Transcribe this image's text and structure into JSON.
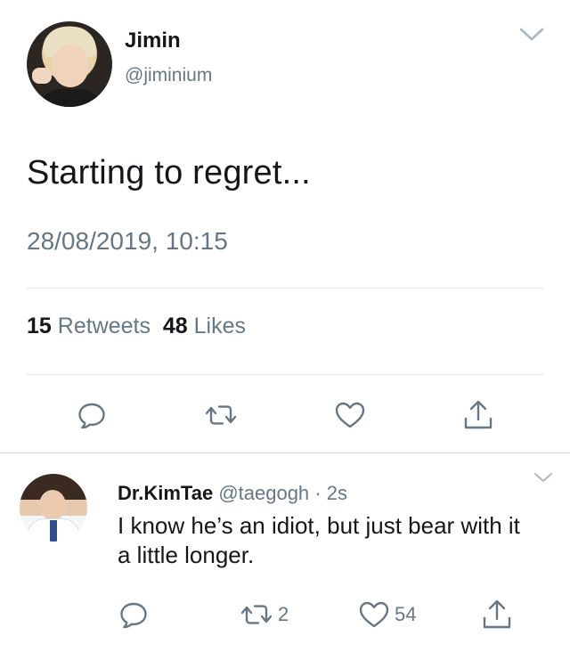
{
  "tweet": {
    "author_name": "Jimin",
    "author_handle": "@jiminium",
    "text": "Starting to regret...",
    "timestamp": "28/08/2019, 10:15",
    "retweets_count": "15",
    "retweets_label": "Retweets",
    "likes_count": "48",
    "likes_label": "Likes"
  },
  "reply": {
    "author_name": "Dr.KimTae",
    "author_handle": "@taegogh",
    "separator": "·",
    "age": "2s",
    "text": "I know he’s an idiot, but just bear with it a little longer.",
    "retweet_count": "2",
    "like_count": "54"
  },
  "icons": {
    "reply": "reply-icon",
    "retweet": "retweet-icon",
    "like": "heart-icon",
    "share": "share-icon",
    "menu": "chevron-down-icon"
  },
  "colors": {
    "text_primary": "#14171a",
    "text_secondary": "#657786",
    "icon_gray": "#657786",
    "divider": "#dfe3e6"
  }
}
